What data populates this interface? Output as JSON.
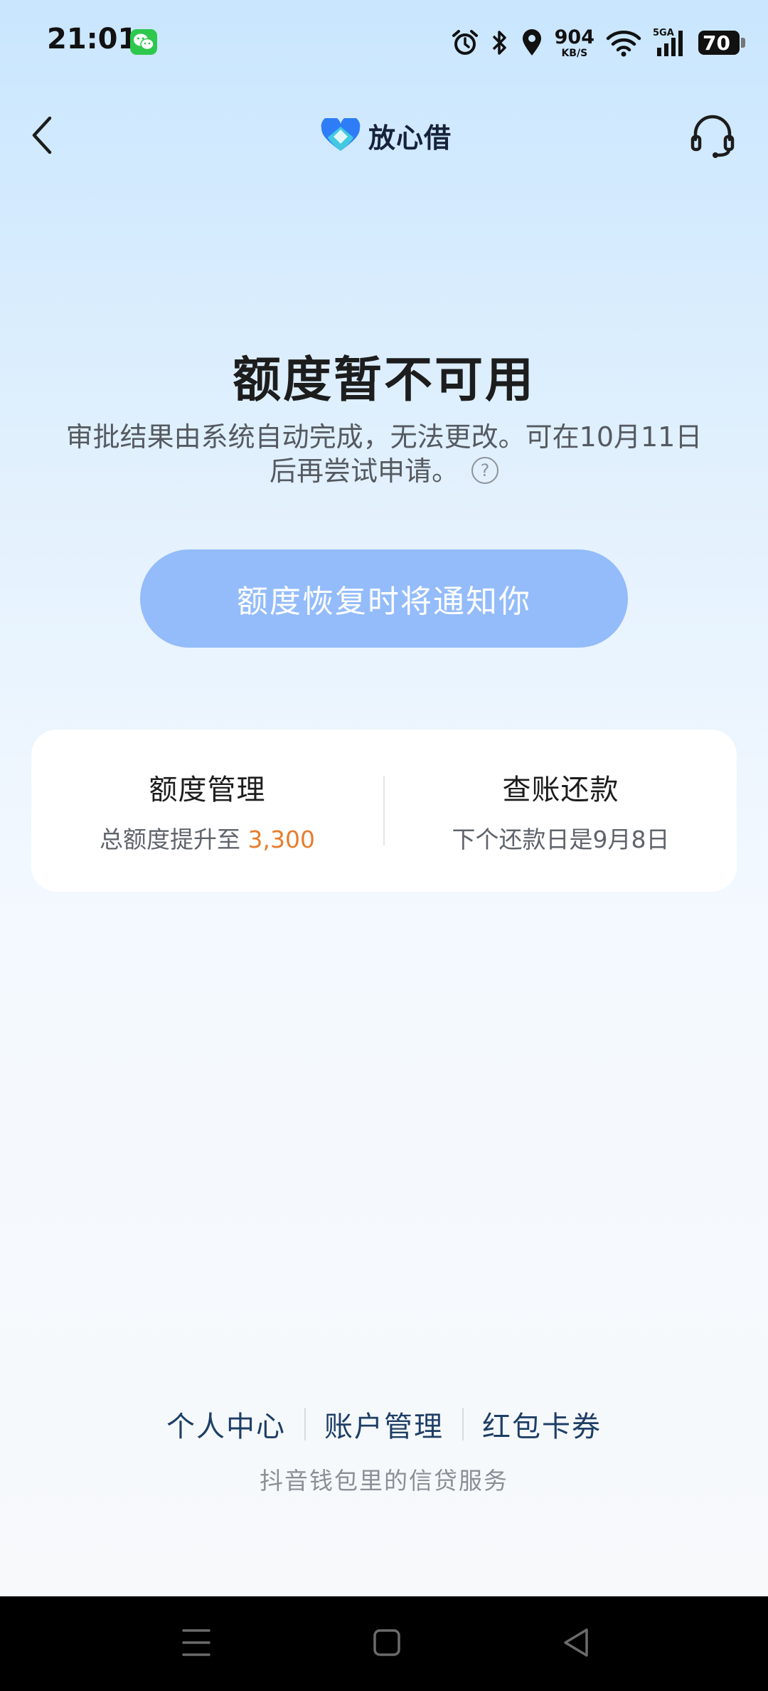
{
  "status_bar": {
    "time": "21:01",
    "net_speed_value": "904",
    "net_speed_unit": "KB/S",
    "signal_label": "5GA",
    "battery_level": "70"
  },
  "header": {
    "brand_name": "放心借"
  },
  "main": {
    "title": "额度暂不可用",
    "description": "审批结果由系统自动完成，无法更改。可在10月11日后再尝试申请。",
    "help_symbol": "?",
    "notify_button_label": "额度恢复时将通知你"
  },
  "card": {
    "left": {
      "title": "额度管理",
      "subtitle_prefix": "总额度提升至 ",
      "amount": "3,300"
    },
    "right": {
      "title": "查账还款",
      "subtitle": "下个还款日是9月8日"
    }
  },
  "footer": {
    "links": [
      "个人中心",
      "账户管理",
      "红包卡券"
    ],
    "note": "抖音钱包里的信贷服务"
  },
  "icons": {
    "back": "chevron-left-icon",
    "support": "headset-icon",
    "brand": "heart-logo-icon"
  },
  "colors": {
    "accent_button": "#94bcfb",
    "amount": "#e77d2e",
    "link": "#1e3f66"
  }
}
